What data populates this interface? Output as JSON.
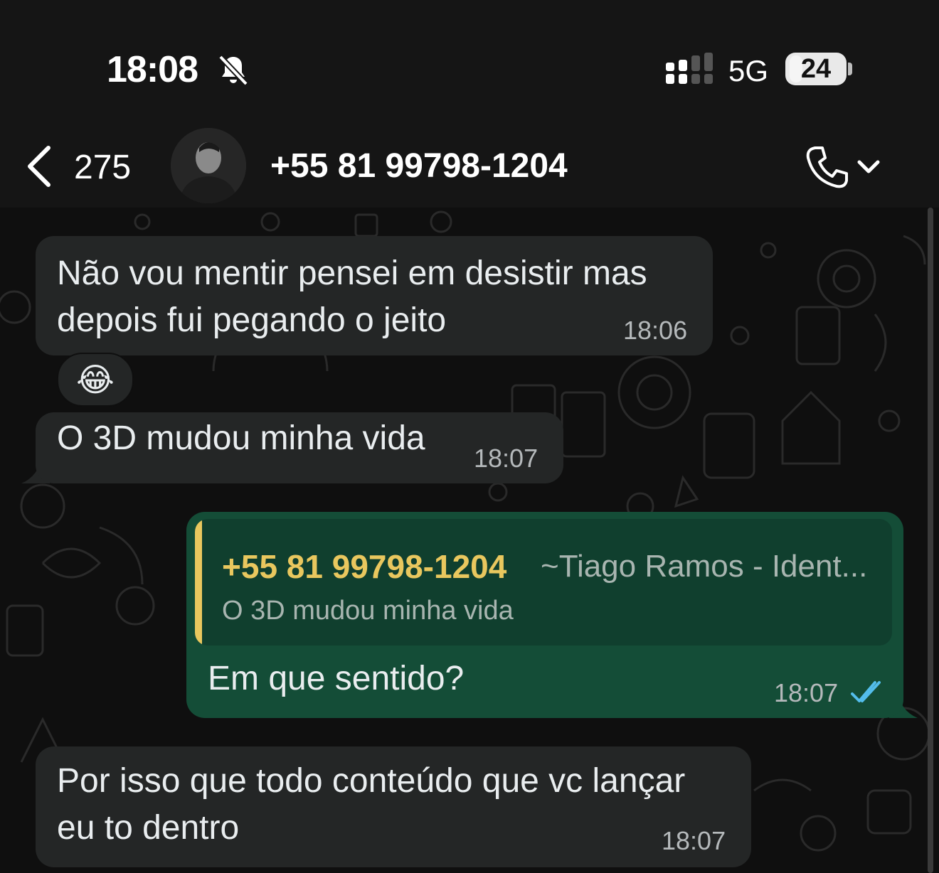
{
  "status_bar": {
    "time": "18:08",
    "network": "5G",
    "battery": "24",
    "battery_level_percent": 24,
    "icons": [
      "bell-slash-icon",
      "signal-icon"
    ]
  },
  "header": {
    "back_count": "275",
    "contact_name": "+55 81 99798-1204",
    "icons": [
      "chevron-left-icon",
      "avatar",
      "phone-icon",
      "chevron-down-icon"
    ]
  },
  "messages": [
    {
      "direction": "incoming",
      "text": "Não vou mentir pensei em desistir mas\ndepois fui pegando o jeito",
      "time": "18:06",
      "reaction": "😂"
    },
    {
      "direction": "incoming",
      "text": "O 3D mudou minha vida",
      "time": "18:07"
    },
    {
      "direction": "outgoing",
      "quote": {
        "sender": "+55 81 99798-1204",
        "alias": "~Tiago Ramos - Ident...",
        "text": "O 3D mudou minha vida"
      },
      "text": "Em que sentido?",
      "time": "18:07",
      "status": "read"
    },
    {
      "direction": "incoming",
      "text": "Por isso que todo conteúdo que vc lançar\neu to dentro",
      "time": "18:07"
    }
  ],
  "colors": {
    "background": "#151515",
    "chat_background": "#0f0f0f",
    "incoming_bubble": "#242626",
    "outgoing_bubble": "#144d37",
    "quote_accent": "#e9c75e",
    "read_ticks": "#53bdeb"
  }
}
